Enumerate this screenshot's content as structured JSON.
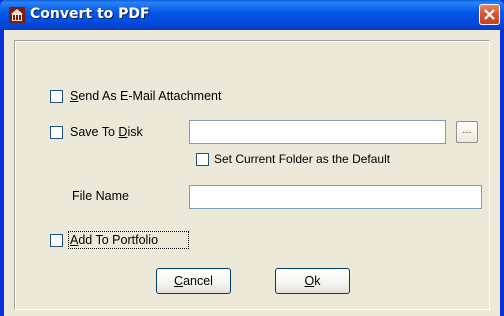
{
  "window": {
    "title": "Convert to PDF",
    "title_icon": "app-icon",
    "close_icon": "close-icon"
  },
  "options": {
    "email": {
      "label_accel": "S",
      "label_rest": "end As E-Mail Attachment",
      "checked": false
    },
    "save_to_disk": {
      "label_pre": "Save To ",
      "label_accel": "D",
      "label_rest": "isk",
      "checked": false,
      "path_value": ""
    },
    "browse_label": "...",
    "default_folder": {
      "label": "Set Current Folder as the Default",
      "checked": false
    },
    "file_name": {
      "label": "File Name",
      "value": ""
    },
    "portfolio": {
      "label_accel": "A",
      "label_rest": "dd To Portfolio",
      "checked": false
    }
  },
  "buttons": {
    "cancel": {
      "accel": "C",
      "rest": "ancel"
    },
    "ok": {
      "accel": "O",
      "rest": "k"
    }
  },
  "colors": {
    "titlebar": "#0246d8",
    "frame": "#0831d9",
    "dialog_bg": "#ece9d8",
    "close_button": "#d9532f"
  }
}
